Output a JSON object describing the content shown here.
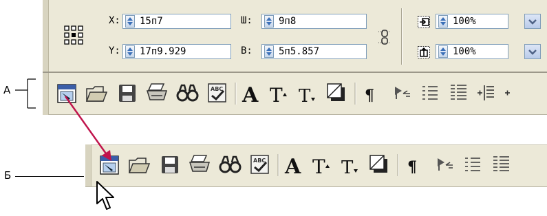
{
  "top_panel": {
    "x_label": "X:",
    "x_value": "15п7",
    "y_label": "Y:",
    "y_value": "17п9.929",
    "w_label": "Ш:",
    "w_value": "9п8",
    "h_label": "В:",
    "h_value": "5п5.857",
    "scale_x_value": "100%",
    "scale_y_value": "100%"
  },
  "callouts": {
    "a_label": "А",
    "b_label": "Б"
  },
  "toolbar": {
    "icons": [
      "new-document",
      "open-folder",
      "save",
      "print",
      "find",
      "spell-check",
      "character",
      "superscript",
      "subscript",
      "drop-shadow",
      "pilcrow",
      "text-wrap",
      "bullet-list",
      "numbered-list",
      "increase-indent"
    ]
  },
  "colors": {
    "panel_bg": "#ece9d8",
    "arrow": "#c0144c",
    "input_border": "#7f9db9"
  }
}
